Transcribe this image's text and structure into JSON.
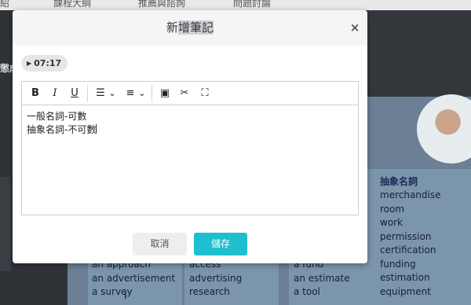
{
  "background": {
    "nav_items": [
      "紹",
      "課程大綱",
      "推薦與諮詢",
      "問題討論"
    ],
    "side_label": "懲成",
    "column_title": "抽象名詞",
    "column1_words": [
      "an approach",
      "an advertisement",
      "a survey"
    ],
    "column2_words": [
      "access",
      "advertising",
      "research"
    ],
    "column3_words": [
      "a fund",
      "an estimate",
      "a tool"
    ],
    "column4_words": [
      "merchandise",
      "room",
      "work",
      "permission",
      "certification",
      "funding",
      "estimation",
      "equipment"
    ]
  },
  "modal": {
    "title_prefix": "新",
    "title_selected": "增筆記",
    "close_label": "×",
    "timestamp": "07:17",
    "play_glyph": "▶",
    "toolbar": {
      "bold": "B",
      "italic": "I",
      "underline": "U",
      "bullet_list": "☰",
      "numbered_list": "≡",
      "dropdown": "⌄",
      "image": "▣",
      "cut": "✂",
      "fullscreen": "⛶"
    },
    "content_lines": [
      "一般名詞-可數",
      "抽象名詞-不可數"
    ],
    "cancel_label": "取消",
    "save_label": "儲存"
  },
  "colors": {
    "accent": "#1fbfd0",
    "header_bg": "#f5f5f5",
    "overlay_bg": "#2f3338"
  }
}
